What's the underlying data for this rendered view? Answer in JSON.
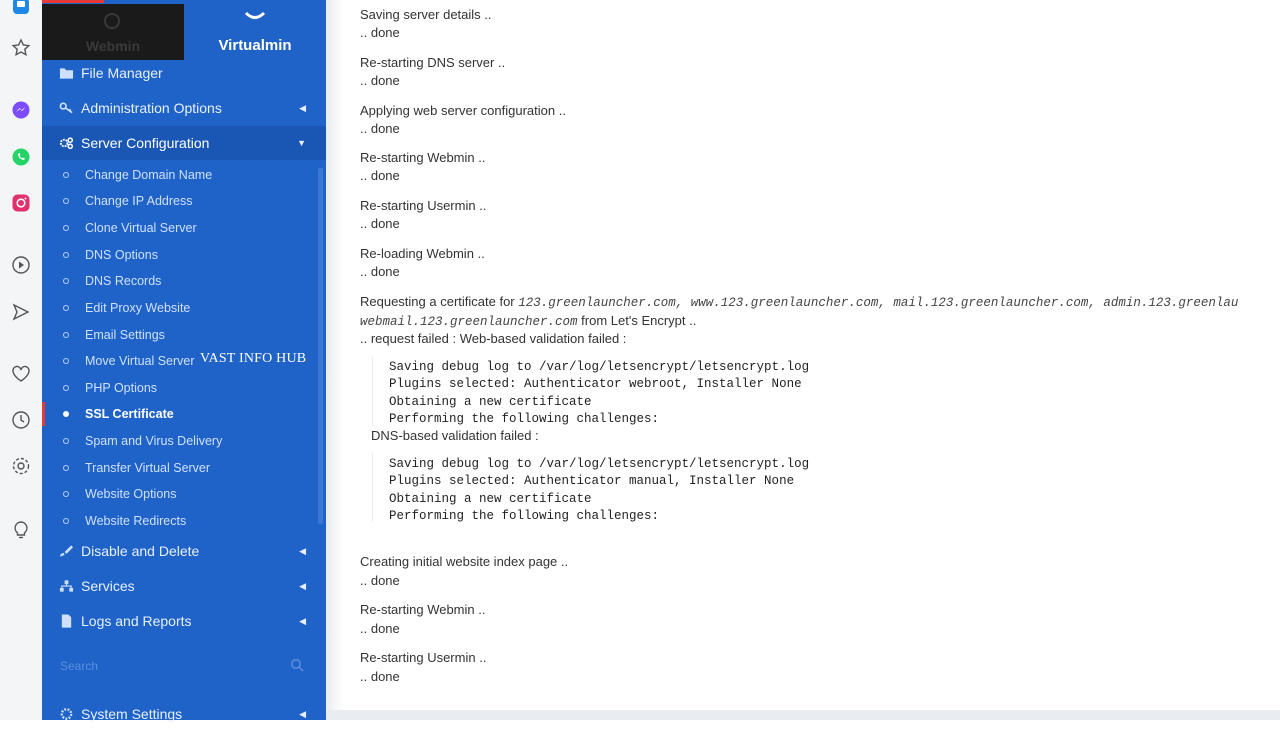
{
  "rail": {
    "icons": [
      "app-icon",
      "star-icon",
      "messenger-icon",
      "whatsapp-icon",
      "instagram-icon",
      "play-icon",
      "send-icon",
      "heart-icon",
      "clock-icon",
      "gear-icon",
      "lightbulb-icon"
    ]
  },
  "tabs": {
    "webmin": "Webmin",
    "virtualmin": "Virtualmin"
  },
  "menu": {
    "file_manager": "File Manager",
    "admin_options": "Administration Options",
    "server_config": "Server Configuration",
    "disable_delete": "Disable and Delete",
    "services": "Services",
    "logs_reports": "Logs and Reports",
    "system_settings": "System Settings"
  },
  "submenu": [
    "Change Domain Name",
    "Change IP Address",
    "Clone Virtual Server",
    "DNS Options",
    "DNS Records",
    "Edit Proxy Website",
    "Email Settings",
    "Move Virtual Server",
    "PHP Options",
    "SSL Certificate",
    "Spam and Virus Delivery",
    "Transfer Virtual Server",
    "Website Options",
    "Website Redirects"
  ],
  "search_placeholder": "Search",
  "watermark": "VAST INFO HUB",
  "log": {
    "l1": "Saving server details ..",
    "l2": "Re-starting DNS server ..",
    "l3": "Applying web server configuration ..",
    "l4": "Re-starting Webmin ..",
    "l5": "Re-starting Usermin ..",
    "l6": "Re-loading Webmin ..",
    "done": ".. done",
    "req_prefix": "Requesting a certificate for",
    "req_domains": "123.greenlauncher.com, www.123.greenlauncher.com, mail.123.greenlauncher.com, admin.123.greenlau",
    "req_domains2": "webmail.123.greenlauncher.com",
    "req_suffix": "from Let's Encrypt ..",
    "web_failed": ".. request failed : Web-based validation failed :",
    "dns_failed": "DNS-based validation failed :",
    "pre1": [
      "Saving debug log to /var/log/letsencrypt/letsencrypt.log",
      "Plugins selected: Authenticator webroot, Installer None",
      "Obtaining a new certificate",
      "Performing the following challenges:"
    ],
    "pre2": [
      "Saving debug log to /var/log/letsencrypt/letsencrypt.log",
      "Plugins selected: Authenticator manual, Installer None",
      "Obtaining a new certificate",
      "Performing the following challenges:"
    ],
    "l7": "Creating initial website index page ..",
    "l8": "Re-starting Webmin ..",
    "l9": "Re-starting Usermin .."
  }
}
